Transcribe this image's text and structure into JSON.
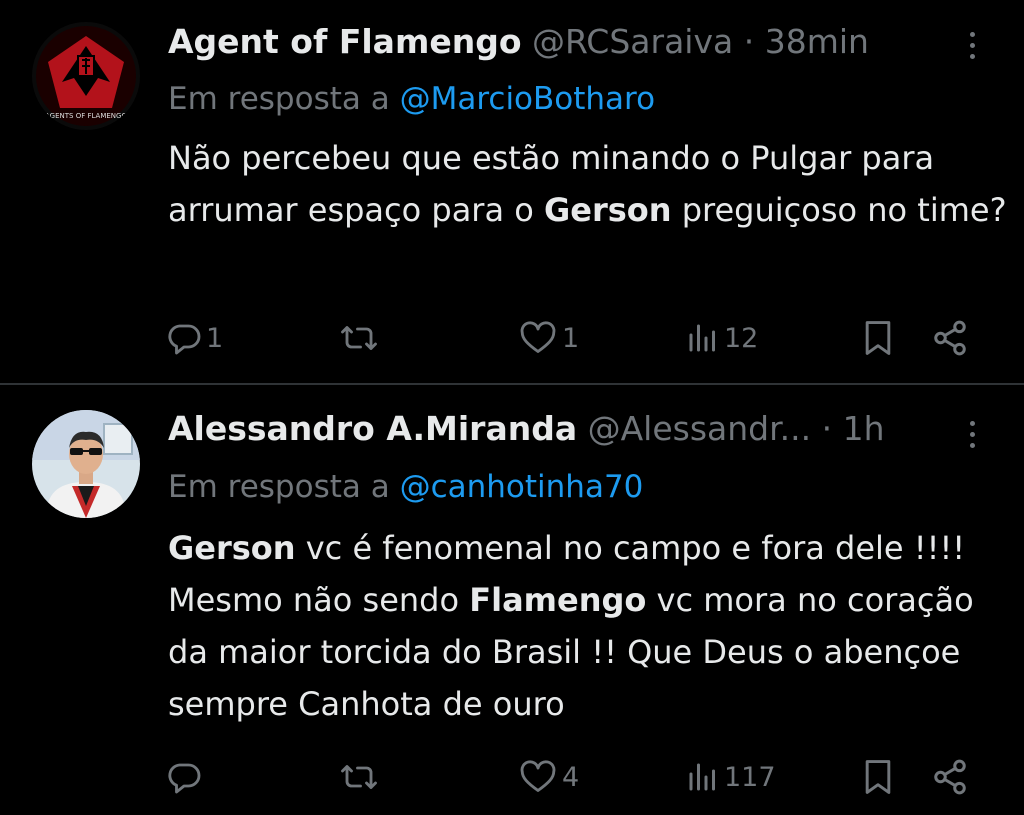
{
  "tweets": [
    {
      "name": "Agent of Flamengo",
      "handle": "@RCSaraiva",
      "time": "· 38min",
      "reply_prefix": "Em resposta a",
      "reply_to": "@MarcioBotharo",
      "text": [
        {
          "t": "Não percebeu que estão minando o Pulgar para arrumar espaço para o "
        },
        {
          "t": "Gerson",
          "bold": true
        },
        {
          "t": " preguiçoso no time?"
        }
      ],
      "avatar_text": "AGENTS OF FLAMENGO",
      "replies": "1",
      "retweets": "",
      "likes": "1",
      "views": "12"
    },
    {
      "name": "Alessandro A.Miranda",
      "handle": "@Alessandr...",
      "time": "· 1h",
      "reply_prefix": "Em resposta a",
      "reply_to": "@canhotinha70",
      "text": [
        {
          "t": "Gerson",
          "bold": true
        },
        {
          "t": " vc é fenomenal no campo e fora dele !!!! Mesmo não sendo "
        },
        {
          "t": "Flamengo",
          "bold": true
        },
        {
          "t": " vc mora no coração da maior torcida do Brasil !! Que Deus o abençoe sempre Canhota de ouro"
        }
      ],
      "replies": "",
      "retweets": "",
      "likes": "4",
      "views": "117"
    }
  ],
  "icons": {
    "reply": "reply-icon",
    "retweet": "retweet-icon",
    "like": "heart-icon",
    "views": "views-icon",
    "bookmark": "bookmark-icon",
    "share": "share-icon",
    "more": "more-icon"
  },
  "colors": {
    "background": "#000000",
    "text": "#e7e9ea",
    "muted": "#71767b",
    "link": "#1d9bf0",
    "divider": "#2f3336",
    "avatar1": "#b3121b"
  }
}
